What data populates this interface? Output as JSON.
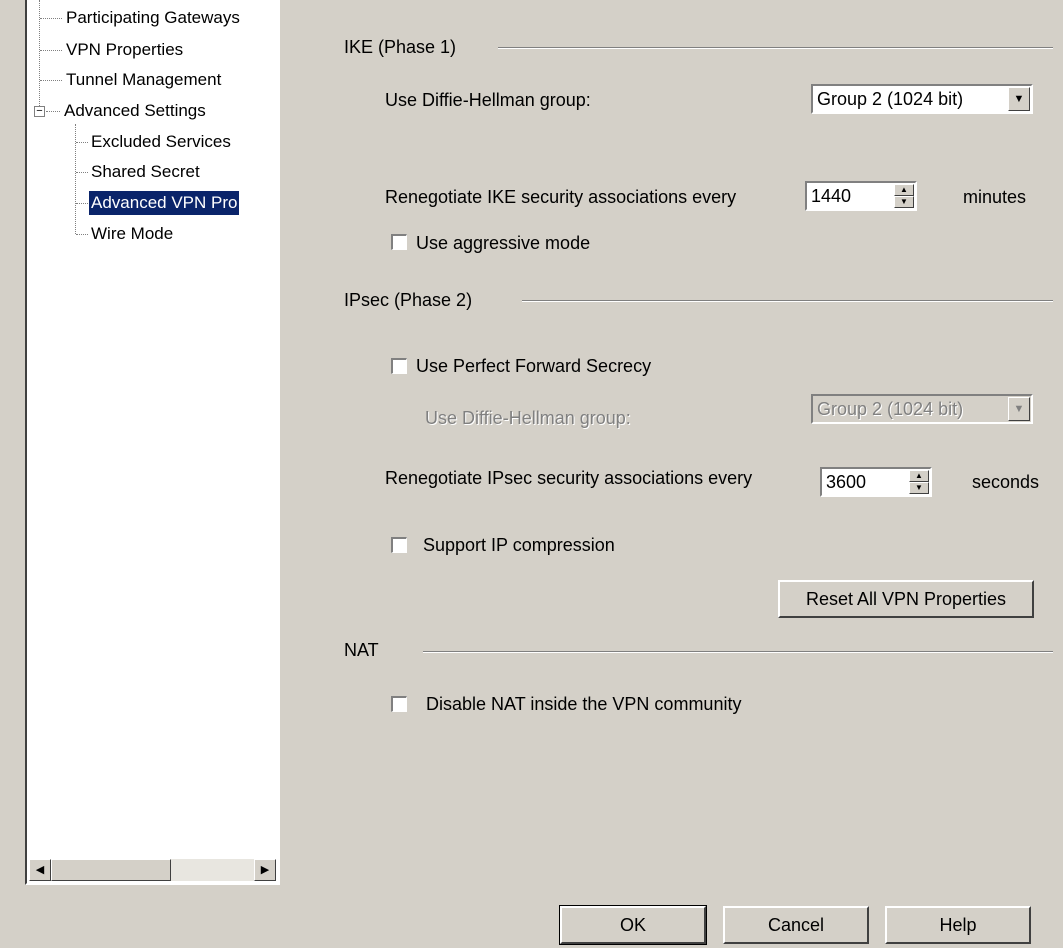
{
  "tree": {
    "items": [
      {
        "label": "Participating Gateways"
      },
      {
        "label": "VPN Properties"
      },
      {
        "label": "Tunnel Management"
      },
      {
        "label": "Advanced Settings"
      },
      {
        "label": "Excluded Services"
      },
      {
        "label": "Shared Secret"
      },
      {
        "label": "Advanced VPN Pro"
      },
      {
        "label": "Wire Mode"
      }
    ],
    "selected_index": 6
  },
  "ike": {
    "title": "IKE (Phase 1)",
    "dh_label": "Use Diffie-Hellman group:",
    "dh_value": "Group 2 (1024 bit)",
    "renegotiate_label": "Renegotiate IKE security associations every",
    "renegotiate_value": "1440",
    "renegotiate_unit": "minutes",
    "aggressive_label": "Use aggressive mode",
    "aggressive_checked": false
  },
  "ipsec": {
    "title": "IPsec (Phase 2)",
    "pfs_label": "Use Perfect Forward Secrecy",
    "pfs_checked": false,
    "dh_label": "Use Diffie-Hellman group:",
    "dh_value": "Group 2 (1024 bit)",
    "renegotiate_label": "Renegotiate IPsec security associations every",
    "renegotiate_value": "3600",
    "renegotiate_unit": "seconds",
    "compression_label": "Support IP compression",
    "compression_checked": false,
    "reset_label": "Reset All VPN Properties"
  },
  "nat": {
    "title": "NAT",
    "disable_label": "Disable NAT inside the VPN community",
    "disable_checked": false
  },
  "footer": {
    "ok_label": "OK",
    "cancel_label": "Cancel",
    "help_label": "Help"
  }
}
